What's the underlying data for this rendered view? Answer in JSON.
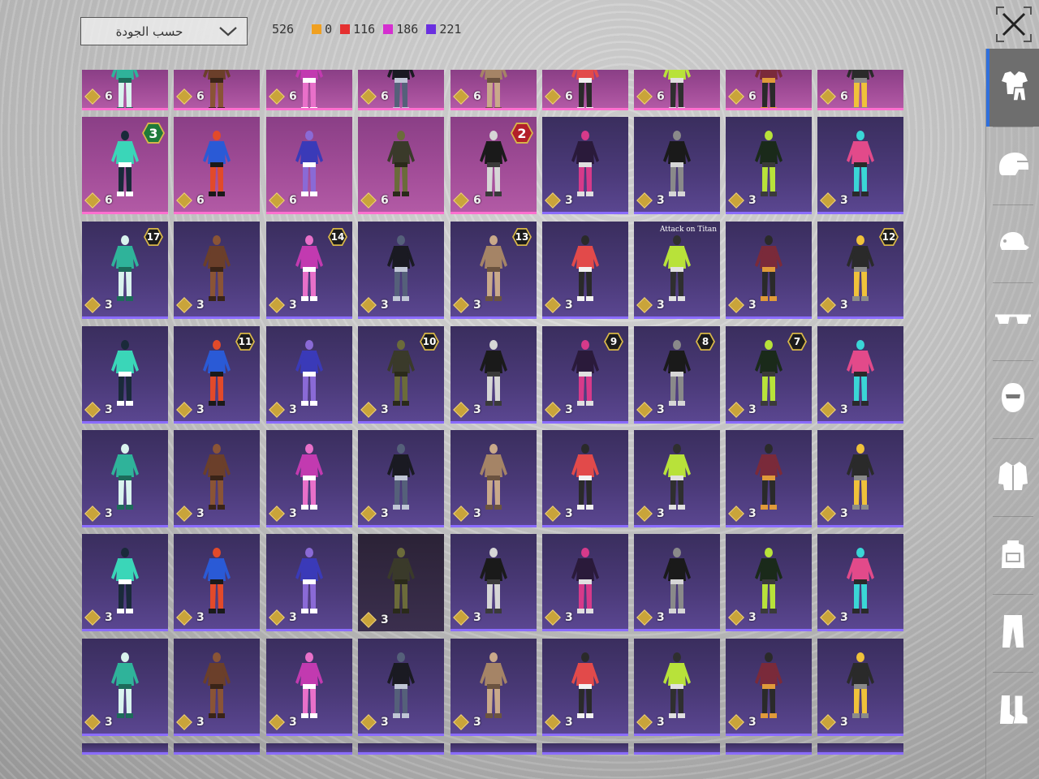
{
  "sort": {
    "label": "حسب الجودة"
  },
  "counts": {
    "total": "526",
    "groups": [
      {
        "color": "#f0a020",
        "value": "0"
      },
      {
        "color": "#e53030",
        "value": "116"
      },
      {
        "color": "#d52fd0",
        "value": "186"
      },
      {
        "color": "#6a2fe0",
        "value": "221"
      }
    ]
  },
  "grid": {
    "rows": [
      [
        {
          "q": "epic",
          "c": "6"
        },
        {
          "q": "epic",
          "c": "6"
        },
        {
          "q": "epic",
          "c": "6"
        },
        {
          "q": "epic",
          "c": "6"
        },
        {
          "q": "epic",
          "c": "6"
        },
        {
          "q": "epic",
          "c": "6"
        },
        {
          "q": "epic",
          "c": "6"
        },
        {
          "q": "epic",
          "c": "6"
        },
        {
          "q": "epic",
          "c": "6"
        }
      ],
      [
        {
          "q": "epic",
          "c": "6",
          "b": "3",
          "bt": "green"
        },
        {
          "q": "epic",
          "c": "6"
        },
        {
          "q": "epic",
          "c": "6"
        },
        {
          "q": "epic",
          "c": "6"
        },
        {
          "q": "epic",
          "c": "6",
          "b": "2",
          "bt": "red"
        },
        {
          "q": "legend",
          "c": "3"
        },
        {
          "q": "legend",
          "c": "3"
        },
        {
          "q": "legend",
          "c": "3"
        },
        {
          "q": "legend",
          "c": "3"
        }
      ],
      [
        {
          "q": "legend",
          "c": "3",
          "b": "17"
        },
        {
          "q": "legend",
          "c": "3"
        },
        {
          "q": "legend",
          "c": "3",
          "b": "14"
        },
        {
          "q": "legend",
          "c": "3"
        },
        {
          "q": "legend",
          "c": "3",
          "b": "13"
        },
        {
          "q": "legend",
          "c": "3"
        },
        {
          "q": "legend",
          "c": "3",
          "logo": "Attack on Titan"
        },
        {
          "q": "legend",
          "c": "3"
        },
        {
          "q": "legend",
          "c": "3",
          "b": "12"
        }
      ],
      [
        {
          "q": "legend",
          "c": "3"
        },
        {
          "q": "legend",
          "c": "3",
          "b": "11"
        },
        {
          "q": "legend",
          "c": "3"
        },
        {
          "q": "legend",
          "c": "3",
          "b": "10"
        },
        {
          "q": "legend",
          "c": "3"
        },
        {
          "q": "legend",
          "c": "3",
          "b": "9"
        },
        {
          "q": "legend",
          "c": "3",
          "b": "8"
        },
        {
          "q": "legend",
          "c": "3",
          "b": "7"
        },
        {
          "q": "legend",
          "c": "3"
        }
      ],
      [
        {
          "q": "legend",
          "c": "3"
        },
        {
          "q": "legend",
          "c": "3"
        },
        {
          "q": "legend",
          "c": "3"
        },
        {
          "q": "legend",
          "c": "3"
        },
        {
          "q": "legend",
          "c": "3"
        },
        {
          "q": "legend",
          "c": "3"
        },
        {
          "q": "legend",
          "c": "3"
        },
        {
          "q": "legend",
          "c": "3"
        },
        {
          "q": "legend",
          "c": "3"
        }
      ],
      [
        {
          "q": "legend",
          "c": "3"
        },
        {
          "q": "legend",
          "c": "3"
        },
        {
          "q": "legend",
          "c": "3"
        },
        {
          "q": "dark",
          "c": "3"
        },
        {
          "q": "legend",
          "c": "3"
        },
        {
          "q": "legend",
          "c": "3"
        },
        {
          "q": "legend",
          "c": "3"
        },
        {
          "q": "legend",
          "c": "3"
        },
        {
          "q": "legend",
          "c": "3"
        }
      ],
      [
        {
          "q": "legend",
          "c": "3"
        },
        {
          "q": "legend",
          "c": "3"
        },
        {
          "q": "legend",
          "c": "3"
        },
        {
          "q": "legend",
          "c": "3"
        },
        {
          "q": "legend",
          "c": "3"
        },
        {
          "q": "legend",
          "c": "3"
        },
        {
          "q": "legend",
          "c": "3"
        },
        {
          "q": "legend",
          "c": "3"
        },
        {
          "q": "legend",
          "c": "3"
        }
      ],
      [
        {
          "q": "legend",
          "c": ""
        },
        {
          "q": "legend",
          "c": ""
        },
        {
          "q": "legend",
          "c": ""
        },
        {
          "q": "legend",
          "c": ""
        },
        {
          "q": "legend",
          "c": ""
        },
        {
          "q": "legend",
          "c": ""
        },
        {
          "q": "legend",
          "c": ""
        },
        {
          "q": "legend",
          "c": ""
        },
        {
          "q": "legend",
          "c": ""
        }
      ]
    ]
  },
  "sidebar": {
    "items": [
      {
        "icon": "outfit-icon",
        "active": true
      },
      {
        "icon": "helmet-icon",
        "active": false
      },
      {
        "icon": "cap-icon",
        "active": false
      },
      {
        "icon": "glasses-icon",
        "active": false
      },
      {
        "icon": "mask-icon",
        "active": false
      },
      {
        "icon": "jacket-icon",
        "active": false
      },
      {
        "icon": "backpack-icon",
        "active": false
      },
      {
        "icon": "pants-icon",
        "active": false
      },
      {
        "icon": "boots-icon",
        "active": false
      }
    ]
  }
}
